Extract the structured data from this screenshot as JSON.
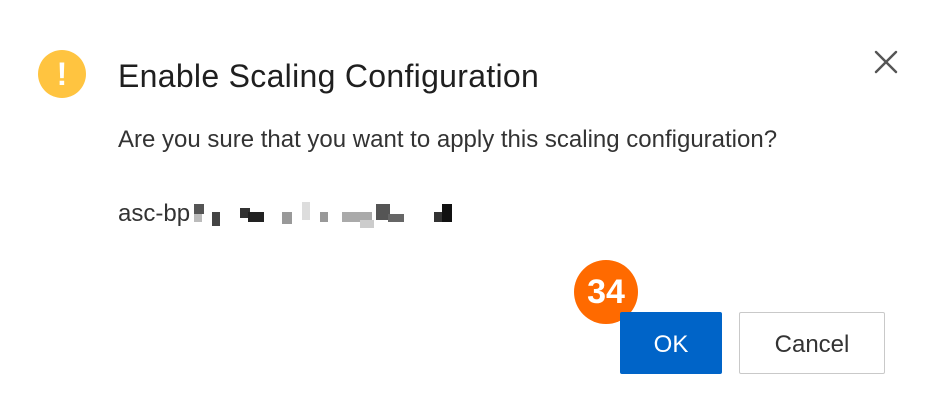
{
  "dialog": {
    "title": "Enable Scaling Configuration",
    "message": "Are you sure that you want to apply this scaling configuration?",
    "id_prefix": "asc-bp",
    "warning_icon": "warning-icon",
    "close_icon": "close-icon"
  },
  "annotation": {
    "step_badge": "34"
  },
  "buttons": {
    "ok_label": "OK",
    "cancel_label": "Cancel"
  },
  "colors": {
    "primary": "#0064c8",
    "warning": "#ffc440",
    "badge": "#ff6a00"
  }
}
